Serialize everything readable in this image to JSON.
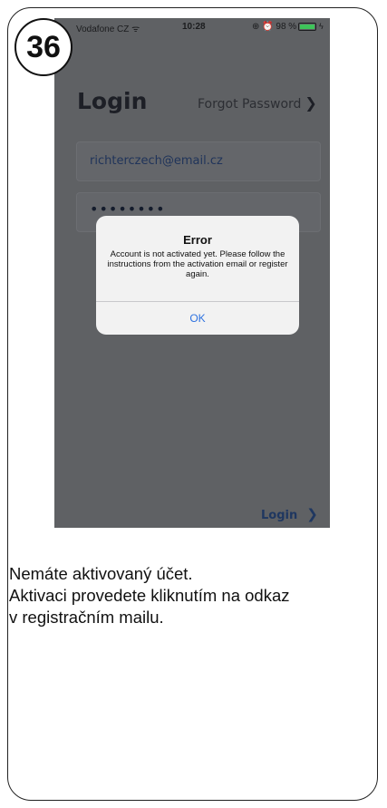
{
  "step_number": "36",
  "phone": {
    "status_bar": {
      "carrier": "Vodafone CZ ᯤ",
      "time": "10:28",
      "right": "⊕ ⏰ 98 %",
      "battery_level": 0.98,
      "charging_icon": "bolt-icon"
    },
    "login": {
      "title": "Login",
      "forgot_password": "Forgot Password",
      "email_value": "richterczech@email.cz",
      "password_value": "••••••••",
      "submit_label": "Login"
    },
    "dialog": {
      "title": "Error",
      "message": "Account is not activated yet. Please follow the instructions from the activation email or register again.",
      "ok_label": "OK"
    }
  },
  "caption": {
    "line1": "Nemáte aktivovaný účet.",
    "line2": "Aktivaci provedete kliknutím na odkaz",
    "line3": "v registračním mailu."
  },
  "colors": {
    "screen_overlay": "#5f6164",
    "dialog_bg": "#f2f2f2",
    "ok_blue": "#2e72e0",
    "battery_green": "#3ec45a"
  }
}
